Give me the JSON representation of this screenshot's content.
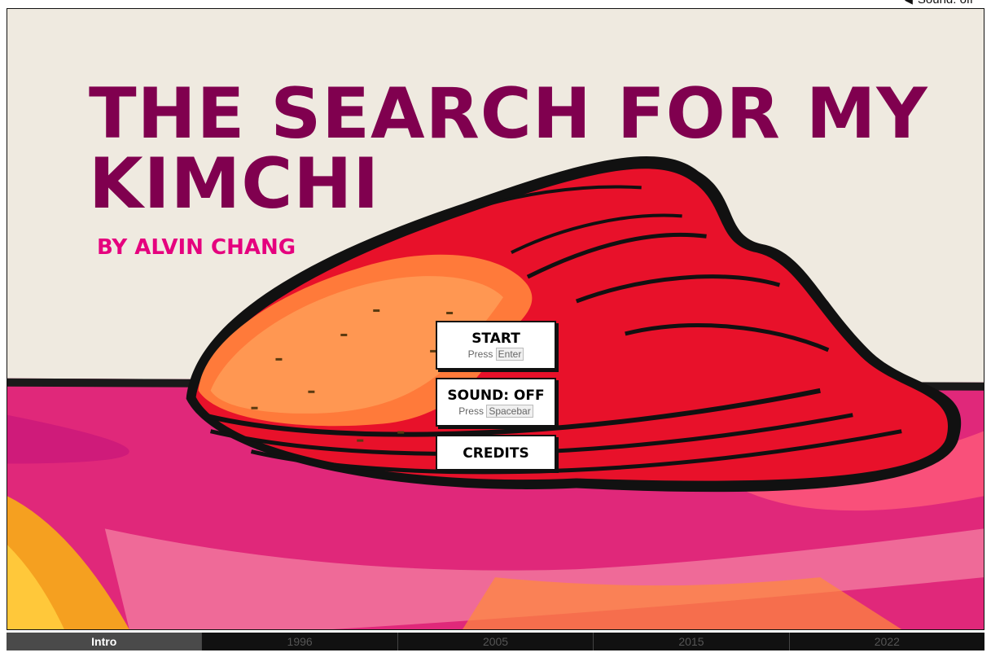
{
  "header": {
    "sound_status": "Sound: off"
  },
  "title": {
    "line1": "THE SEARCH FOR MY",
    "line2": "KIMCHI",
    "byline": "BY ALVIN CHANG"
  },
  "menu": {
    "start": {
      "label": "START",
      "press": "Press",
      "key": "Enter"
    },
    "sound": {
      "label": "SOUND: OFF",
      "press": "Press",
      "key": "Spacebar"
    },
    "credits": {
      "label": "CREDITS"
    }
  },
  "chapters": [
    {
      "label": "Intro",
      "active": true
    },
    {
      "label": "1996",
      "active": false
    },
    {
      "label": "2005",
      "active": false
    },
    {
      "label": "2015",
      "active": false
    },
    {
      "label": "2022",
      "active": false
    }
  ],
  "colors": {
    "title": "#80004f",
    "byline": "#e5007e",
    "paper": "#efeae0",
    "chapter_active_bg": "#4a4a4a",
    "chapter_bar_bg": "#111111"
  },
  "icons": {
    "sound": "speaker-icon"
  }
}
